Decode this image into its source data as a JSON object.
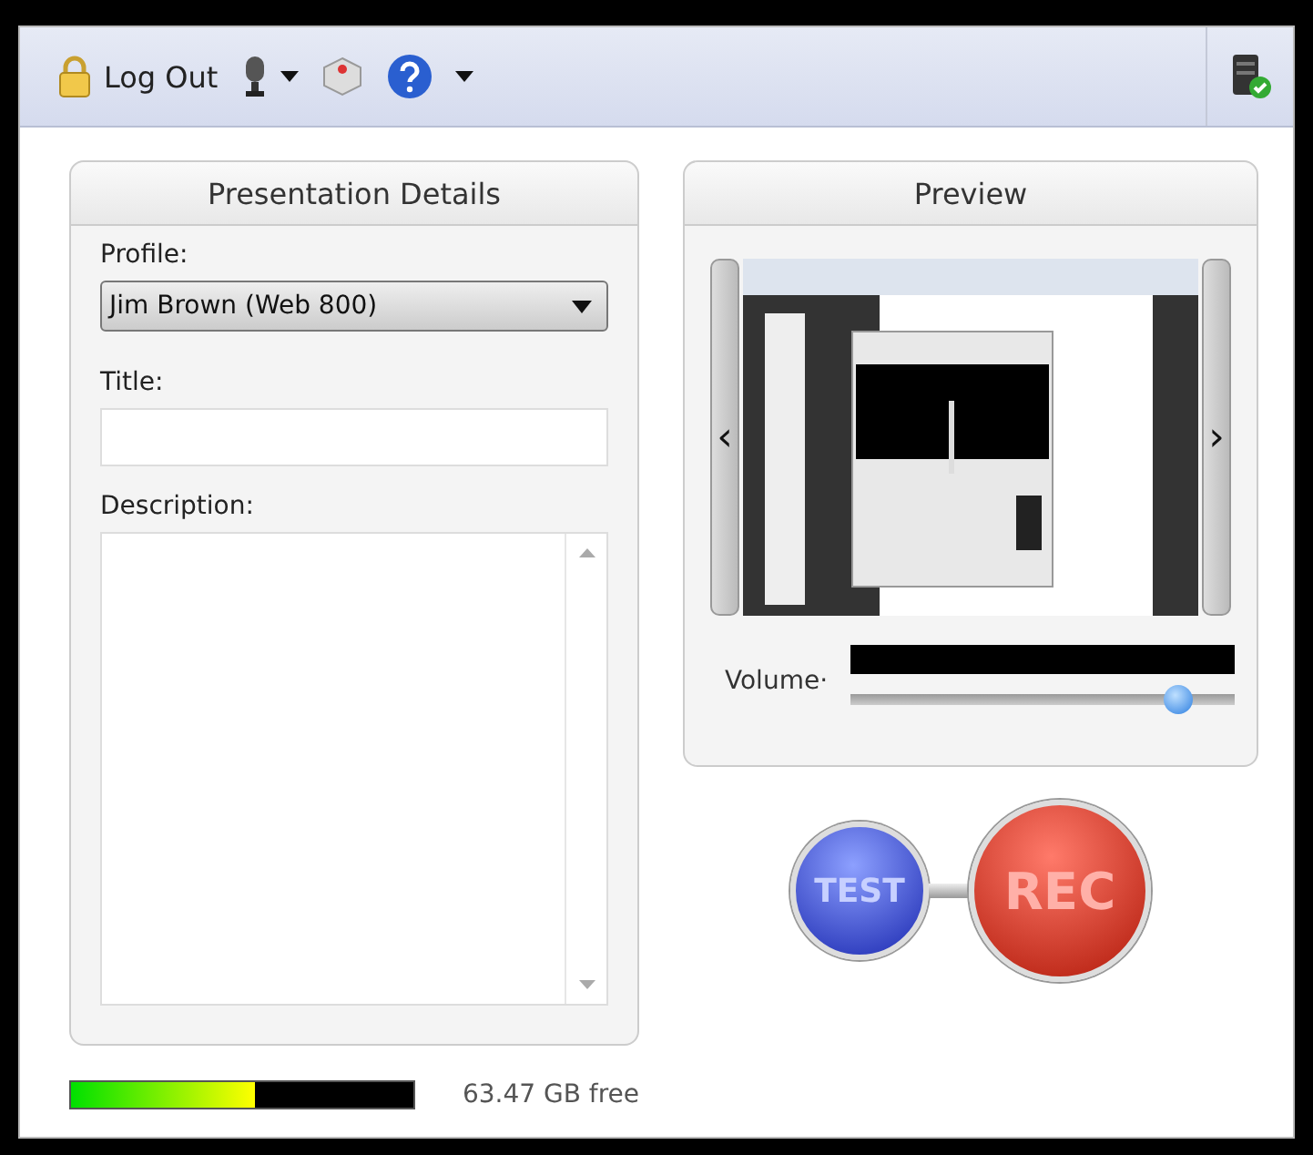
{
  "toolbar": {
    "logout_label": "Log Out"
  },
  "details": {
    "title": "Presentation Details",
    "profile_label": "Profile:",
    "profile_value": "Jim Brown (Web 800)",
    "title_label": "Title:",
    "description_label": "Description:"
  },
  "preview": {
    "title": "Preview",
    "prev_arrow": "‹",
    "next_arrow": "›",
    "volume_label": "Volume·",
    "volume": {
      "level": 0.88
    }
  },
  "record_buttons": [
    "TEST",
    "REC"
  ],
  "storage": {
    "level": 0.54,
    "text": "63.47 GB free"
  }
}
